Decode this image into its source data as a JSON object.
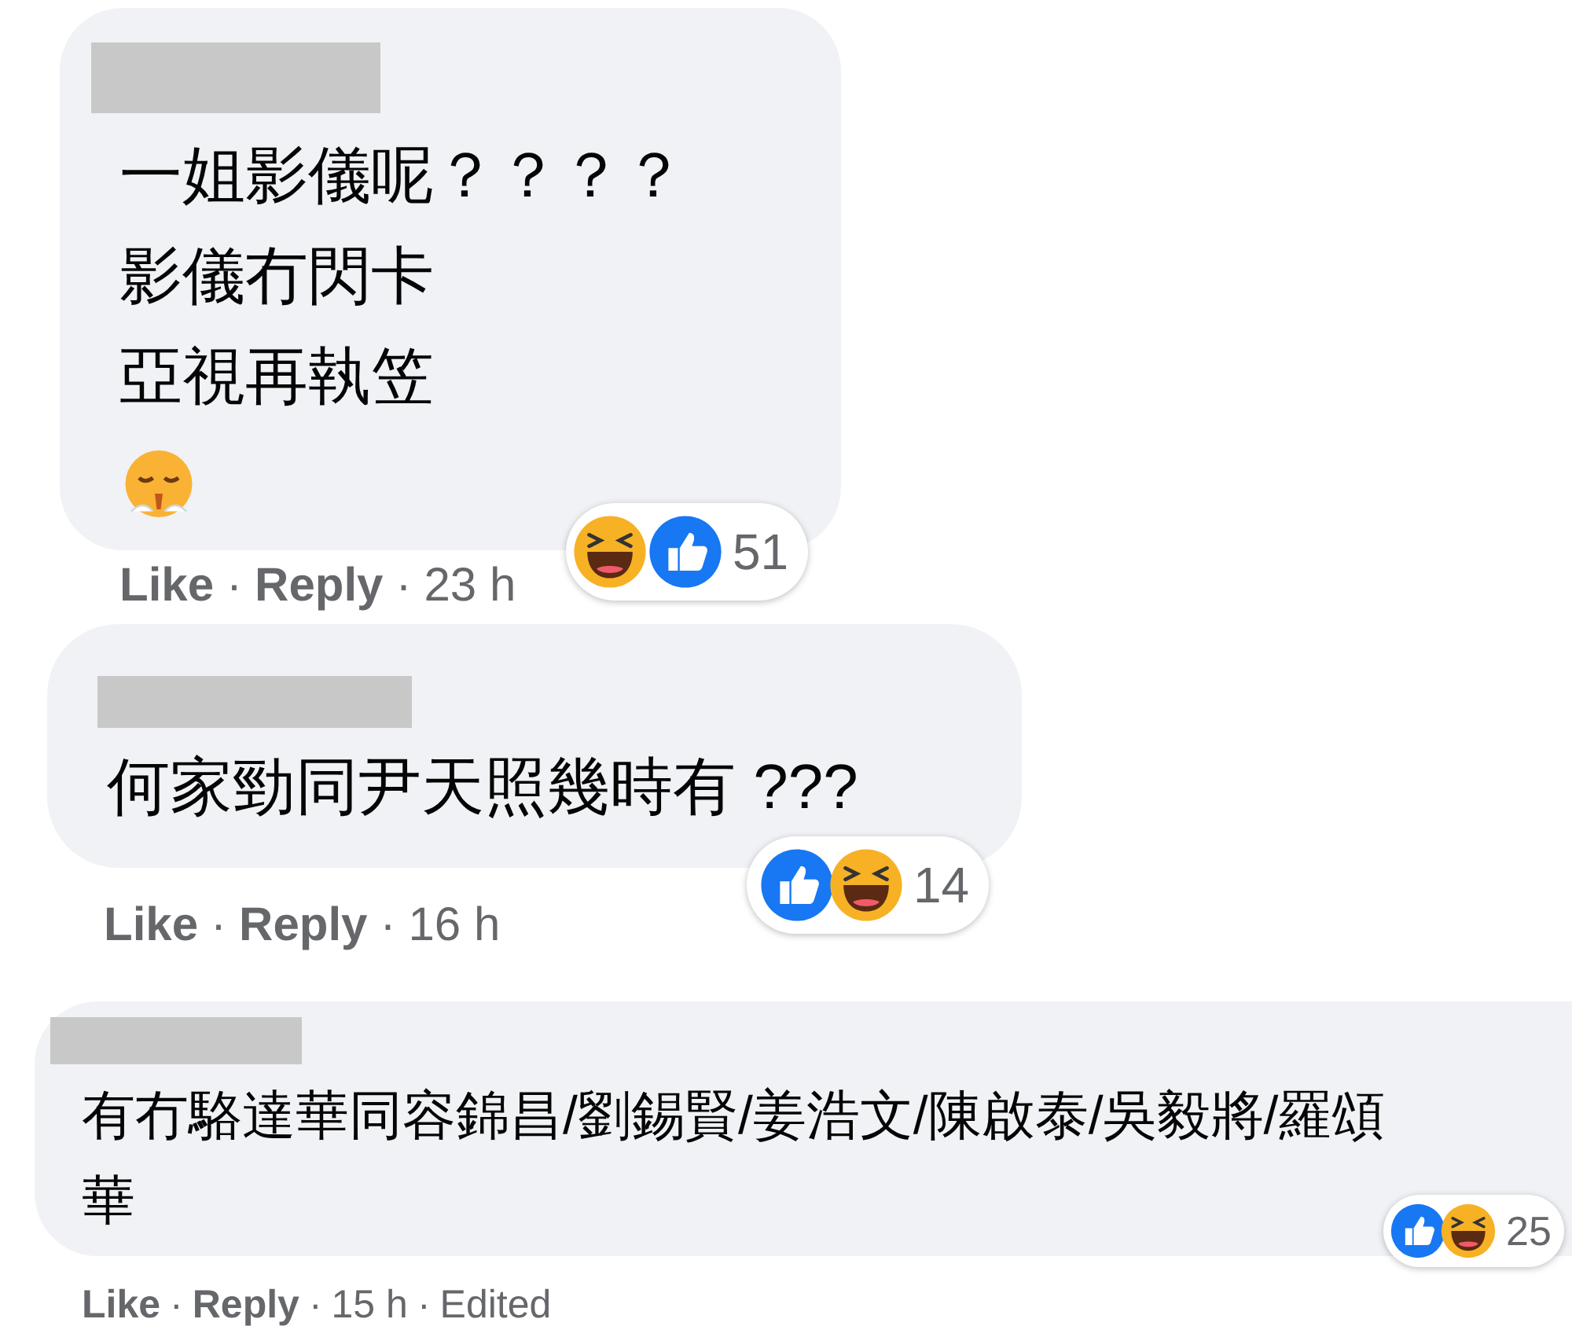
{
  "comments": [
    {
      "lines": [
        "一姐影儀呢？？？？",
        "影儀冇閃卡",
        "亞視再執笠"
      ],
      "emoji": {
        "kind": "steam_face"
      },
      "reactions": [
        {
          "kind": "haha"
        },
        {
          "kind": "like"
        }
      ],
      "reaction_count": "51",
      "footer": [
        {
          "kind": "link",
          "text": "Like"
        },
        {
          "kind": "sep",
          "text": "·"
        },
        {
          "kind": "link",
          "text": "Reply"
        },
        {
          "kind": "sep",
          "text": "·"
        },
        {
          "kind": "time",
          "text": "23 h"
        }
      ]
    },
    {
      "lines": [
        "何家勁同尹天照幾時有 ???"
      ],
      "reactions": [
        {
          "kind": "like"
        },
        {
          "kind": "haha"
        }
      ],
      "reaction_count": "14",
      "footer": [
        {
          "kind": "link",
          "text": "Like"
        },
        {
          "kind": "sep",
          "text": "·"
        },
        {
          "kind": "link",
          "text": "Reply"
        },
        {
          "kind": "sep",
          "text": "·"
        },
        {
          "kind": "time",
          "text": "16 h"
        }
      ]
    },
    {
      "lines": [
        "有冇駱達華同容錦昌/劉錫賢/姜浩文/陳啟泰/吳毅將/羅頌",
        "華"
      ],
      "reactions": [
        {
          "kind": "like"
        },
        {
          "kind": "haha"
        }
      ],
      "reaction_count": "25",
      "footer": [
        {
          "kind": "link",
          "text": "Like"
        },
        {
          "kind": "sep",
          "text": "·"
        },
        {
          "kind": "link",
          "text": "Reply"
        },
        {
          "kind": "sep",
          "text": "·"
        },
        {
          "kind": "time",
          "text": "15 h"
        },
        {
          "kind": "sep",
          "text": "·"
        },
        {
          "kind": "note",
          "text": "Edited"
        }
      ]
    }
  ]
}
